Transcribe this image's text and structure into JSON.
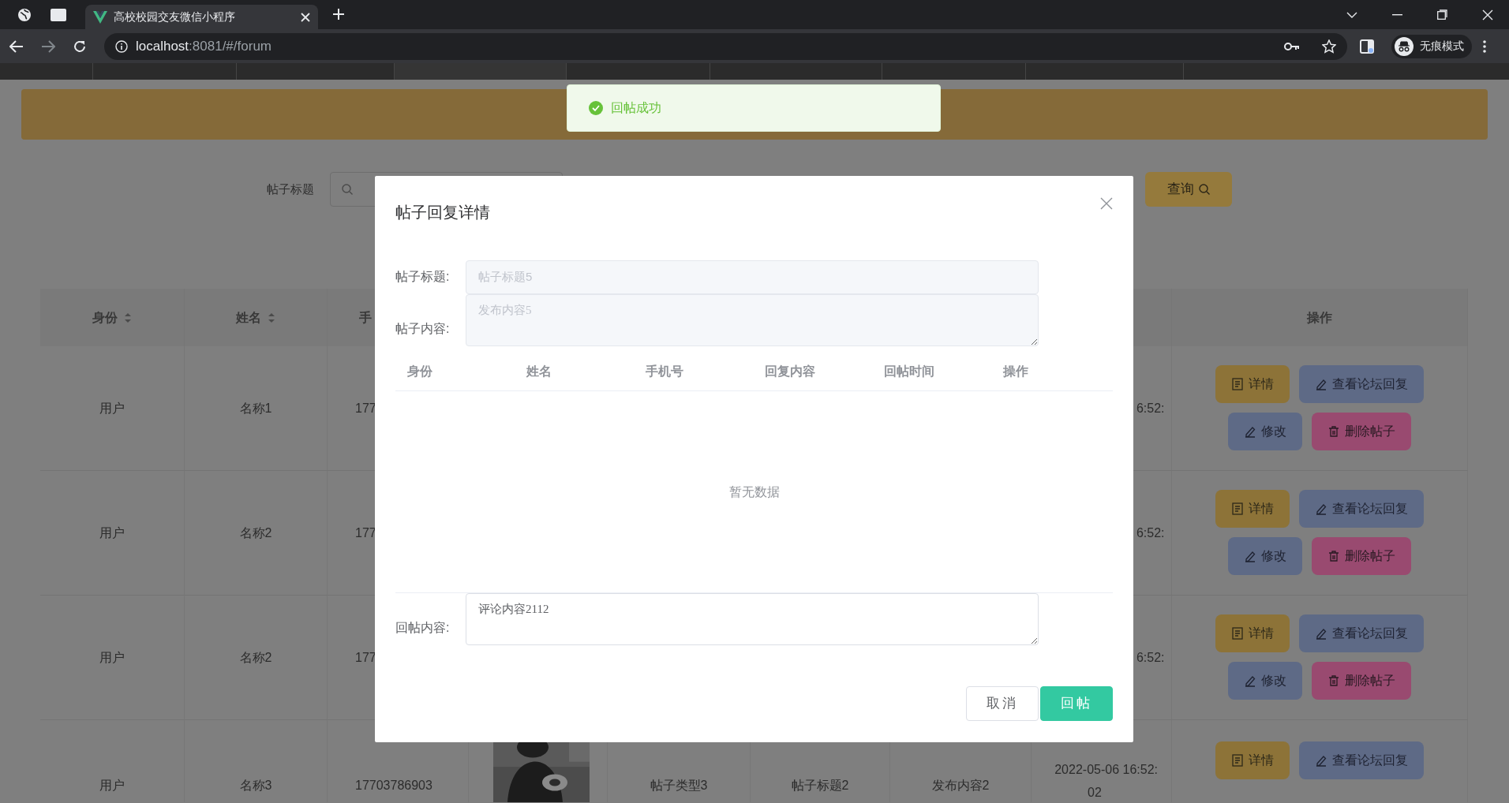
{
  "browser": {
    "tab_title": "高校校园交友微信小程序",
    "url_host": "localhost",
    "url_rest": ":8081/#/forum",
    "profile_label": "无痕模式"
  },
  "toast": {
    "message": "回帖成功"
  },
  "search": {
    "label": "帖子标题",
    "query_button": "查询"
  },
  "table": {
    "columns": [
      {
        "label": "身份",
        "sortable": true
      },
      {
        "label": "姓名",
        "sortable": true
      },
      {
        "label": "手",
        "sortable": false
      }
    ],
    "action_column": "操作",
    "rows": [
      {
        "identity": "用户",
        "name": "名称1",
        "phone": "177",
        "time": [
          "6:52:"
        ],
        "actions": [
          {
            "label": "详情",
            "kind": "detail"
          },
          {
            "label": "查看论坛回复",
            "kind": "replies"
          },
          {
            "label": "修改",
            "kind": "edit"
          },
          {
            "label": "删除帖子",
            "kind": "delete"
          }
        ]
      },
      {
        "identity": "用户",
        "name": "名称2",
        "phone": "177",
        "time": [
          "6:52:"
        ],
        "actions": [
          {
            "label": "详情",
            "kind": "detail"
          },
          {
            "label": "查看论坛回复",
            "kind": "replies"
          },
          {
            "label": "修改",
            "kind": "edit"
          },
          {
            "label": "删除帖子",
            "kind": "delete"
          }
        ]
      },
      {
        "identity": "用户",
        "name": "名称2",
        "phone": "177",
        "time": [
          "6:52:"
        ],
        "actions": [
          {
            "label": "详情",
            "kind": "detail"
          },
          {
            "label": "查看论坛回复",
            "kind": "replies"
          },
          {
            "label": "修改",
            "kind": "edit"
          },
          {
            "label": "删除帖子",
            "kind": "delete"
          }
        ]
      },
      {
        "identity": "用户",
        "name": "名称3",
        "phone": "17703786903",
        "picture": {
          "kind": "picture"
        },
        "type": "帖子类型3",
        "title": "帖子标题2",
        "content": "发布内容2",
        "time": [
          "2022-05-06 16:52:",
          "02"
        ],
        "actions": [
          {
            "label": "详情",
            "kind": "detail"
          },
          {
            "label": "查看论坛回复",
            "kind": "replies"
          }
        ]
      }
    ]
  },
  "dialog": {
    "title": "帖子回复详情",
    "fields": [
      {
        "label": "帖子标题:",
        "kind": "input",
        "value": "帖子标题5",
        "disabled": true
      },
      {
        "label": "帖子内容:",
        "kind": "textarea",
        "value": "发布内容5",
        "disabled": true
      }
    ],
    "reply_table": {
      "columns": [
        "身份",
        "姓名",
        "手机号",
        "回复内容",
        "回帖时间",
        "操作"
      ],
      "empty_text": "暂无数据"
    },
    "reply_field": {
      "label": "回帖内容:",
      "value": "评论内容2112"
    },
    "buttons": [
      {
        "label": "取消",
        "kind": "default"
      },
      {
        "label": "回帖",
        "kind": "primary"
      }
    ]
  }
}
